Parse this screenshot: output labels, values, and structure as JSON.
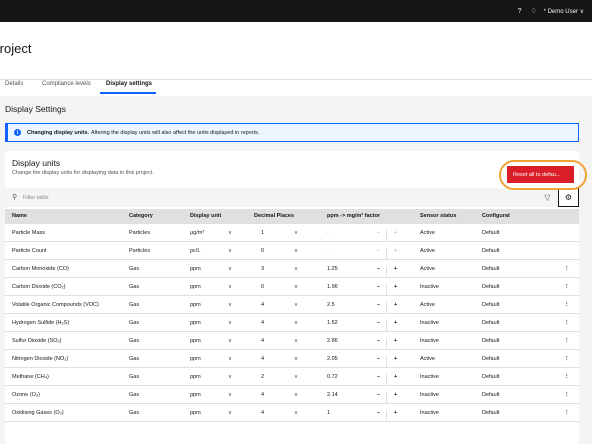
{
  "topbar": {
    "help_icon": "help-icon",
    "notifications_icon": "notifications-icon",
    "user_label": "* Demo User ∨"
  },
  "page": {
    "title": "Project"
  },
  "tabs": [
    {
      "label": "Details"
    },
    {
      "label": "Compliance levels"
    },
    {
      "label": "Display settings",
      "active": true
    }
  ],
  "section": {
    "title": "Display Settings"
  },
  "notice": {
    "title": "Changing display units.",
    "text": "Altering the display units will also affect the units displayed in reports."
  },
  "panel": {
    "title": "Display units",
    "description": "Change the display units for displaying data in this project."
  },
  "toolbar": {
    "filter_placeholder": "Filter table",
    "reset_label": "Reset all to defau..."
  },
  "table": {
    "headers": {
      "name": "Name",
      "category": "Category",
      "display_unit": "Display unit",
      "decimal_places": "Decimal Places",
      "factor": "ppm -> mg/m³ factor",
      "sensor_status": "Sensor status",
      "configuration": "Configurat"
    },
    "rows": [
      {
        "name": "Particle Mass",
        "category": "Particles",
        "unit": "µg/m³",
        "decimals": "1",
        "factor": "-",
        "status": "Active",
        "config": "Default"
      },
      {
        "name": "Particle Count",
        "category": "Particles",
        "unit": "pc/L",
        "decimals": "0",
        "factor": "-",
        "status": "Active",
        "config": "Default"
      },
      {
        "name": "Carbon Monoxide (CO)",
        "category": "Gas",
        "unit": "ppm",
        "decimals": "3",
        "factor": "1.25",
        "status": "Active",
        "config": "Default"
      },
      {
        "name": "Carbon Dioxide (CO₂)",
        "category": "Gas",
        "unit": "ppm",
        "decimals": "0",
        "factor": "1.96",
        "status": "Inactive",
        "config": "Default"
      },
      {
        "name": "Volatile Organic Compounds (VOC)",
        "category": "Gas",
        "unit": "ppm",
        "decimals": "4",
        "factor": "2.5",
        "status": "Active",
        "config": "Default"
      },
      {
        "name": "Hydrogen Sulfide (H₂S)",
        "category": "Gas",
        "unit": "ppm",
        "decimals": "4",
        "factor": "1.52",
        "status": "Inactive",
        "config": "Default"
      },
      {
        "name": "Sulfur Dioxide (SO₂)",
        "category": "Gas",
        "unit": "ppm",
        "decimals": "4",
        "factor": "2.86",
        "status": "Inactive",
        "config": "Default"
      },
      {
        "name": "Nitrogen Dioxide (NO₂)",
        "category": "Gas",
        "unit": "ppm",
        "decimals": "4",
        "factor": "2.05",
        "status": "Active",
        "config": "Default"
      },
      {
        "name": "Methane (CH₄)",
        "category": "Gas",
        "unit": "ppm",
        "decimals": "2",
        "factor": "0.72",
        "status": "Inactive",
        "config": "Default"
      },
      {
        "name": "Ozone (O₃)",
        "category": "Gas",
        "unit": "ppm",
        "decimals": "4",
        "factor": "2.14",
        "status": "Inactive",
        "config": "Default"
      },
      {
        "name": "Oxidising Gases (O₃)",
        "category": "Gas",
        "unit": "ppm",
        "decimals": "4",
        "factor": "1",
        "status": "Inactive",
        "config": "Default"
      }
    ]
  }
}
